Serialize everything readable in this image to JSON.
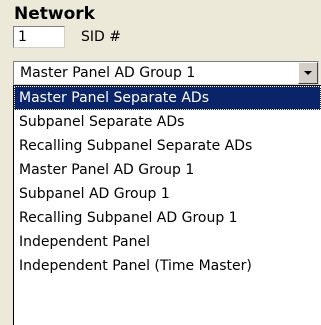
{
  "network": {
    "title": "Network",
    "sid_value": "1",
    "sid_label": "SID #"
  },
  "combo": {
    "value": "Master Panel AD Group 1",
    "button_icon": "chevron-down-icon"
  },
  "dropdown": {
    "items": [
      {
        "label": "Master Panel Separate ADs",
        "selected": true
      },
      {
        "label": "Subpanel Separate ADs",
        "selected": false
      },
      {
        "label": "Recalling Subpanel Separate ADs",
        "selected": false
      },
      {
        "label": "Master Panel AD Group 1",
        "selected": false
      },
      {
        "label": "Subpanel AD Group 1",
        "selected": false
      },
      {
        "label": "Recalling Subpanel AD Group 1",
        "selected": false
      },
      {
        "label": "Independent Panel",
        "selected": false
      },
      {
        "label": "Independent Panel (Time Master)",
        "selected": false
      }
    ]
  },
  "colors": {
    "background": "#ece9d8",
    "selection": "#0a246a",
    "selection_text": "#ffffff"
  }
}
